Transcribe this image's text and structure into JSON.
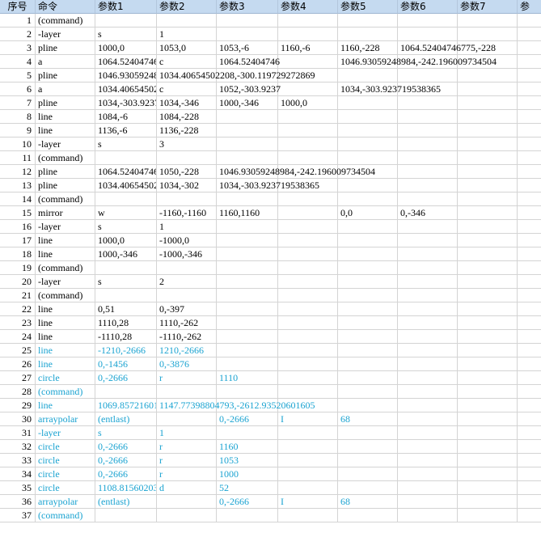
{
  "header": [
    "序号",
    "命令",
    "参数1",
    "参数2",
    "参数3",
    "参数4",
    "参数5",
    "参数6",
    "参数7",
    "参"
  ],
  "colors": {
    "header_bg": "#c5daf0",
    "grid": "#d4d4d4",
    "text_black": "#000000",
    "text_cyan": "#1aa3d1"
  },
  "rows": [
    {
      "n": "1",
      "c": [
        "(command)",
        "",
        "",
        "",
        "",
        "",
        "",
        ""
      ],
      "color": "black"
    },
    {
      "n": "2",
      "c": [
        "-layer",
        "s",
        "1",
        "",
        "",
        "",
        "",
        ""
      ],
      "color": "black"
    },
    {
      "n": "3",
      "c": [
        "pline",
        "1000,0",
        "1053,0",
        "1053,-6",
        "1160,-6",
        "1160,-228",
        "1064.52404746775,-228",
        ""
      ],
      "color": "black"
    },
    {
      "n": "4",
      "c": [
        "a",
        "1064.52404746",
        "c",
        "1064.52404746",
        "",
        "1046.93059248984,-242.196009734504",
        "",
        ""
      ],
      "color": "black"
    },
    {
      "n": "5",
      "c": [
        "pline",
        "1046.93059248",
        "1034.40654502208,-300.119729272869",
        "",
        "",
        "",
        "",
        ""
      ],
      "color": "black"
    },
    {
      "n": "6",
      "c": [
        "a",
        "1034.40654502",
        "c",
        "1052,-303.9237",
        "",
        "1034,-303.923719538365",
        "",
        ""
      ],
      "color": "black"
    },
    {
      "n": "7",
      "c": [
        "pline",
        "1034,-303.9237",
        "1034,-346",
        "1000,-346",
        "1000,0",
        "",
        "",
        ""
      ],
      "color": "black"
    },
    {
      "n": "8",
      "c": [
        "line",
        "1084,-6",
        "1084,-228",
        "",
        "",
        "",
        "",
        ""
      ],
      "color": "black"
    },
    {
      "n": "9",
      "c": [
        "line",
        "1136,-6",
        "1136,-228",
        "",
        "",
        "",
        "",
        ""
      ],
      "color": "black"
    },
    {
      "n": "10",
      "c": [
        "-layer",
        "s",
        "3",
        "",
        "",
        "",
        "",
        ""
      ],
      "color": "black"
    },
    {
      "n": "11",
      "c": [
        "(command)",
        "",
        "",
        "",
        "",
        "",
        "",
        ""
      ],
      "color": "black"
    },
    {
      "n": "12",
      "c": [
        "pline",
        "1064.52404746",
        "1050,-228",
        "1046.93059248984,-242.196009734504",
        "",
        "",
        "",
        ""
      ],
      "color": "black"
    },
    {
      "n": "13",
      "c": [
        "pline",
        "1034.40654502",
        "1034,-302",
        "1034,-303.923719538365",
        "",
        "",
        "",
        ""
      ],
      "color": "black"
    },
    {
      "n": "14",
      "c": [
        "(command)",
        "",
        "",
        "",
        "",
        "",
        "",
        ""
      ],
      "color": "black"
    },
    {
      "n": "15",
      "c": [
        "mirror",
        "w",
        "-1160,-1160",
        "1160,1160",
        "",
        "0,0",
        "0,-346",
        ""
      ],
      "color": "black"
    },
    {
      "n": "16",
      "c": [
        "-layer",
        "s",
        "1",
        "",
        "",
        "",
        "",
        ""
      ],
      "color": "black"
    },
    {
      "n": "17",
      "c": [
        "line",
        "1000,0",
        "-1000,0",
        "",
        "",
        "",
        "",
        ""
      ],
      "color": "black"
    },
    {
      "n": "18",
      "c": [
        "line",
        "1000,-346",
        "-1000,-346",
        "",
        "",
        "",
        "",
        ""
      ],
      "color": "black"
    },
    {
      "n": "19",
      "c": [
        "(command)",
        "",
        "",
        "",
        "",
        "",
        "",
        ""
      ],
      "color": "black"
    },
    {
      "n": "20",
      "c": [
        "-layer",
        "s",
        "2",
        "",
        "",
        "",
        "",
        ""
      ],
      "color": "black"
    },
    {
      "n": "21",
      "c": [
        "(command)",
        "",
        "",
        "",
        "",
        "",
        "",
        ""
      ],
      "color": "black"
    },
    {
      "n": "22",
      "c": [
        "line",
        "0,51",
        "0,-397",
        "",
        "",
        "",
        "",
        ""
      ],
      "color": "black"
    },
    {
      "n": "23",
      "c": [
        "line",
        "1110,28",
        "1110,-262",
        "",
        "",
        "",
        "",
        ""
      ],
      "color": "black"
    },
    {
      "n": "24",
      "c": [
        "line",
        "-1110,28",
        "-1110,-262",
        "",
        "",
        "",
        "",
        ""
      ],
      "color": "black"
    },
    {
      "n": "25",
      "c": [
        "line",
        "-1210,-2666",
        "1210,-2666",
        "",
        "",
        "",
        "",
        ""
      ],
      "color": "cyan"
    },
    {
      "n": "26",
      "c": [
        "line",
        "0,-1456",
        "0,-3876",
        "",
        "",
        "",
        "",
        ""
      ],
      "color": "cyan"
    },
    {
      "n": "27",
      "c": [
        "circle",
        "0,-2666",
        "r",
        "1110",
        "",
        "",
        "",
        ""
      ],
      "color": "cyan"
    },
    {
      "n": "28",
      "c": [
        "(command)",
        "",
        "",
        "",
        "",
        "",
        "",
        ""
      ],
      "color": "cyan"
    },
    {
      "n": "29",
      "c": [
        "line",
        "1069.85721601",
        "1147.77398804793,-2612.93520601605",
        "",
        "",
        "",
        "",
        ""
      ],
      "color": "cyan"
    },
    {
      "n": "30",
      "c": [
        "arraypolar",
        "(entlast)",
        "",
        "0,-2666",
        "I",
        "68",
        "",
        ""
      ],
      "color": "cyan"
    },
    {
      "n": "31",
      "c": [
        "-layer",
        "s",
        "1",
        "",
        "",
        "",
        "",
        ""
      ],
      "color": "cyan"
    },
    {
      "n": "32",
      "c": [
        "circle",
        "0,-2666",
        "r",
        "1160",
        "",
        "",
        "",
        ""
      ],
      "color": "cyan"
    },
    {
      "n": "33",
      "c": [
        "circle",
        "0,-2666",
        "r",
        "1053",
        "",
        "",
        "",
        ""
      ],
      "color": "cyan"
    },
    {
      "n": "34",
      "c": [
        "circle",
        "0,-2666",
        "r",
        "1000",
        "",
        "",
        "",
        ""
      ],
      "color": "cyan"
    },
    {
      "n": "35",
      "c": [
        "circle",
        "1108.81560203",
        "d",
        "52",
        "",
        "",
        "",
        ""
      ],
      "color": "cyan"
    },
    {
      "n": "36",
      "c": [
        "arraypolar",
        "(entlast)",
        "",
        "0,-2666",
        "I",
        "68",
        "",
        ""
      ],
      "color": "cyan"
    },
    {
      "n": "37",
      "c": [
        "(command)",
        "",
        "",
        "",
        "",
        "",
        "",
        ""
      ],
      "color": "cyan"
    }
  ]
}
